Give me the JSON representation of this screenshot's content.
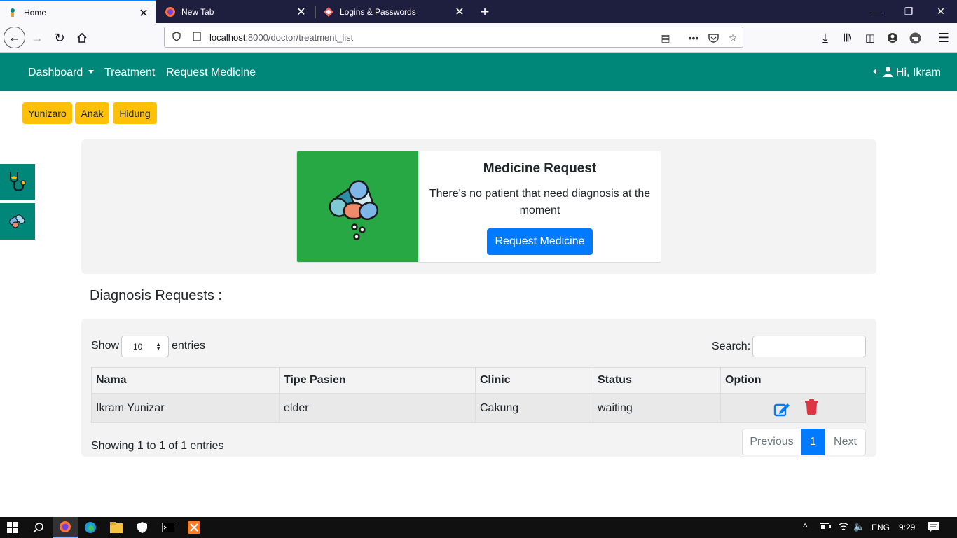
{
  "browser": {
    "tabs": [
      {
        "label": "Home",
        "active": true
      },
      {
        "label": "New Tab",
        "active": false
      },
      {
        "label": "Logins & Passwords",
        "active": false
      }
    ],
    "url": {
      "host": "localhost",
      "path": ":8000/doctor/treatment_list"
    }
  },
  "nav": {
    "dashboard": "Dashboard",
    "treatment": "Treatment",
    "request_medicine": "Request Medicine",
    "user": "Hi, Ikram",
    "brand_color": "#00877a"
  },
  "badges": [
    "Yunizaro",
    "Anak",
    "Hidung"
  ],
  "card": {
    "title": "Medicine Request",
    "text": "There's no patient that need diagnosis at the moment",
    "button": "Request Medicine"
  },
  "diagnosis": {
    "title": "Diagnosis Requests :",
    "show_label": "Show",
    "entries_value": "10",
    "entries_label": "entries",
    "search_label": "Search:",
    "columns": [
      "Nama",
      "Tipe Pasien",
      "Clinic",
      "Status",
      "Option"
    ],
    "rows": [
      {
        "nama": "Ikram Yunizar",
        "tipe": "elder",
        "clinic": "Cakung",
        "status": "waiting"
      }
    ],
    "info": "Showing 1 to 1 of 1 entries",
    "pagination": {
      "previous": "Previous",
      "current": "1",
      "next": "Next"
    }
  },
  "taskbar": {
    "lang": "ENG",
    "time": "9:29"
  }
}
